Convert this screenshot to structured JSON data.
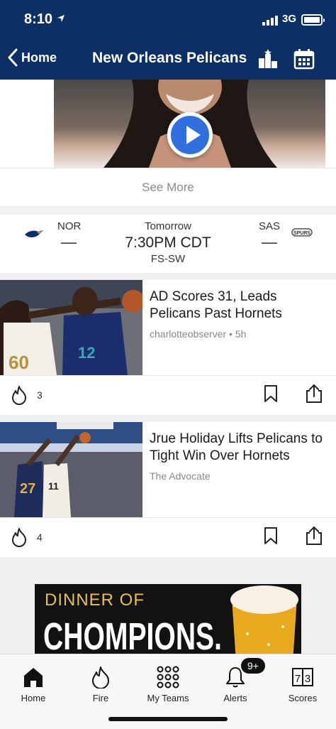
{
  "status_bar": {
    "time": "8:10",
    "network": "3G"
  },
  "nav": {
    "back_label": "Home",
    "title": "New Orleans Pelicans"
  },
  "video": {
    "see_more_label": "See More"
  },
  "game": {
    "home_team": "NOR",
    "away_team": "SAS",
    "home_score": "—",
    "away_score": "—",
    "day": "Tomorrow",
    "time": "7:30PM CDT",
    "channel": "FS-SW"
  },
  "news": [
    {
      "title": "AD Scores 31, Leads Pelicans Past Hornets",
      "source": "charlotteobserver • 5h",
      "fire_count": "3"
    },
    {
      "title": "Jrue Holiday Lifts Pelicans to Tight Win Over Hornets",
      "source": "The Advocate",
      "fire_count": "4"
    }
  ],
  "ad": {
    "text_line1": "DINNER OF",
    "text_line2": "CHOMPIONS."
  },
  "tabs": [
    {
      "label": "Home",
      "icon": "home-icon"
    },
    {
      "label": "Fire",
      "icon": "fire-icon"
    },
    {
      "label": "My Teams",
      "icon": "grid-icon"
    },
    {
      "label": "Alerts",
      "icon": "bell-icon"
    },
    {
      "label": "Scores",
      "icon": "scores-icon"
    }
  ],
  "alerts_badge": "9+",
  "colors": {
    "header": "#0c2f66",
    "play_button": "#2f6fe0",
    "ad_yellow": "#e7c04a"
  }
}
